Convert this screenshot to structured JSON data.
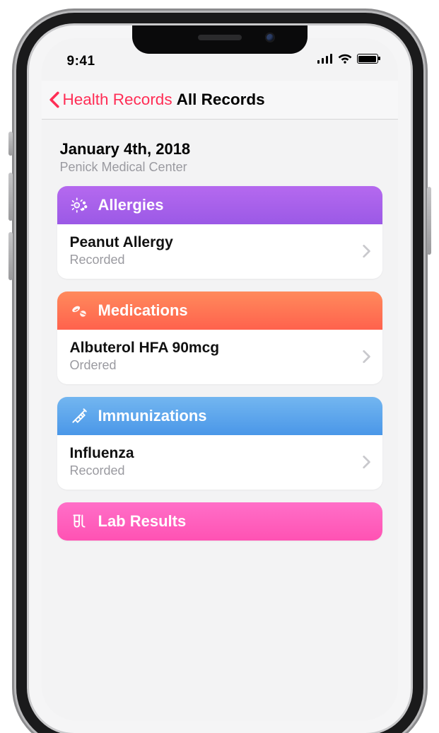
{
  "status": {
    "time": "9:41"
  },
  "nav": {
    "back_label": "Health Records",
    "title": "All Records"
  },
  "header": {
    "date": "January 4th, 2018",
    "facility": "Penick Medical Center"
  },
  "sections": [
    {
      "id": "allergies",
      "title": "Allergies",
      "gradient": "grad-purple",
      "icon": "allergy-sun-icon",
      "item": {
        "title": "Peanut Allergy",
        "status": "Recorded"
      }
    },
    {
      "id": "medications",
      "title": "Medications",
      "gradient": "grad-orange",
      "icon": "pills-icon",
      "item": {
        "title": "Albuterol HFA 90mcg",
        "status": "Ordered"
      }
    },
    {
      "id": "immunizations",
      "title": "Immunizations",
      "gradient": "grad-blue",
      "icon": "syringe-icon",
      "item": {
        "title": "Influenza",
        "status": "Recorded"
      }
    },
    {
      "id": "lab-results",
      "title": "Lab Results",
      "gradient": "grad-pink",
      "icon": "test-tubes-icon",
      "item": null
    }
  ],
  "colors": {
    "accent": "#ff2d55"
  }
}
